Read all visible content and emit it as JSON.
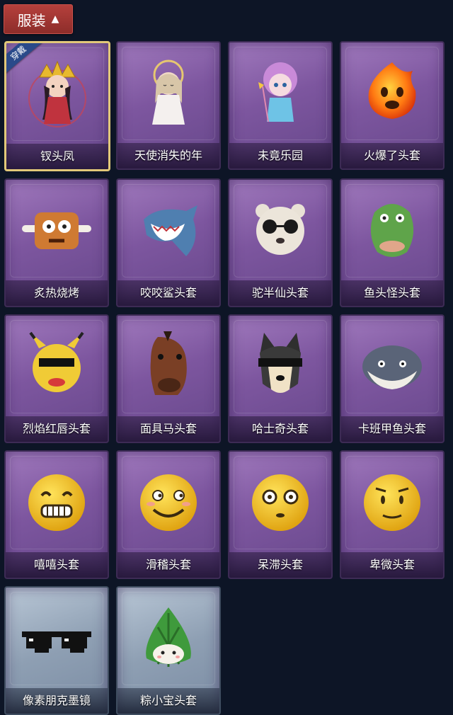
{
  "header": {
    "tab_label": "服装",
    "chevron": "▲"
  },
  "items": [
    {
      "name": "钗头凤",
      "icon": "phoenix-crown-figure-icon",
      "badge": "穿戴",
      "equipped": true,
      "rarity": "purple"
    },
    {
      "name": "天使消失的年",
      "icon": "angel-figure-icon",
      "rarity": "purple"
    },
    {
      "name": "未竟乐园",
      "icon": "paradise-girl-figure-icon",
      "rarity": "purple"
    },
    {
      "name": "火爆了头套",
      "icon": "fireball-head-icon",
      "rarity": "purple"
    },
    {
      "name": "炙热烧烤",
      "icon": "bbq-meat-head-icon",
      "rarity": "purple"
    },
    {
      "name": "咬咬鲨头套",
      "icon": "shark-head-icon",
      "rarity": "purple"
    },
    {
      "name": "驼半仙头套",
      "icon": "bear-sunglasses-head-icon",
      "rarity": "purple"
    },
    {
      "name": "鱼头怪头套",
      "icon": "fish-head-icon",
      "rarity": "purple"
    },
    {
      "name": "烈焰红唇头套",
      "icon": "pikachu-mask-icon",
      "rarity": "purple"
    },
    {
      "name": "面具马头套",
      "icon": "horse-mask-icon",
      "rarity": "purple"
    },
    {
      "name": "哈士奇头套",
      "icon": "husky-head-icon",
      "rarity": "purple"
    },
    {
      "name": "卡班甲鱼头套",
      "icon": "pufferfish-head-icon",
      "rarity": "purple"
    },
    {
      "name": "嘻嘻头套",
      "icon": "grin-emoji-head-icon",
      "rarity": "purple"
    },
    {
      "name": "滑稽头套",
      "icon": "smirk-emoji-head-icon",
      "rarity": "purple"
    },
    {
      "name": "呆滞头套",
      "icon": "dazed-emoji-head-icon",
      "rarity": "purple"
    },
    {
      "name": "卑微头套",
      "icon": "humble-emoji-head-icon",
      "rarity": "purple"
    },
    {
      "name": "像素朋克墨镜",
      "icon": "pixel-sunglasses-icon",
      "rarity": "silver"
    },
    {
      "name": "粽小宝头套",
      "icon": "zongzi-head-icon",
      "rarity": "silver"
    }
  ],
  "colors": {
    "background": "#0d1526",
    "tab": "#a63a36",
    "card_purple": "#8a62ab",
    "card_silver": "#9aabbf",
    "equipped_border": "#e2c879"
  }
}
